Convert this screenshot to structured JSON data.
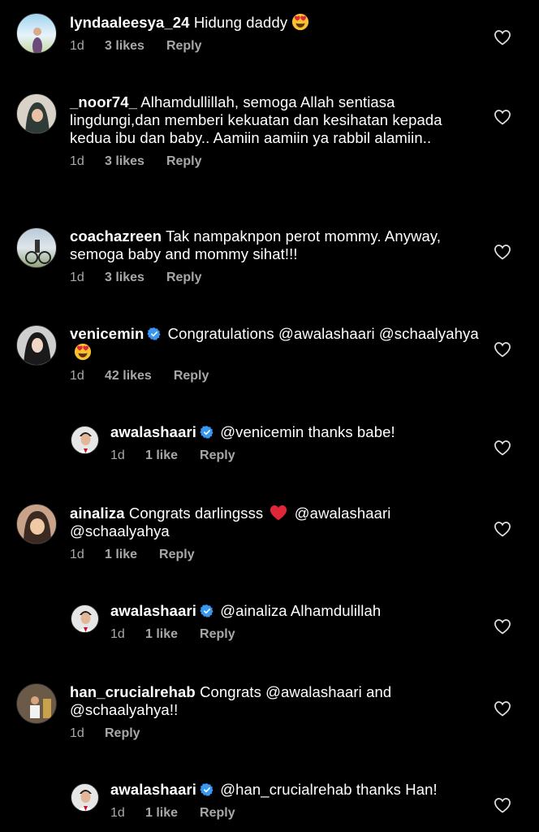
{
  "comments": [
    {
      "username": "lyndaaleesya_24",
      "verified": false,
      "text": "Hidung daddy",
      "emoji": "heart-eyes",
      "time": "1d",
      "likes": "3 likes",
      "reply": "Reply"
    },
    {
      "username": "_noor74_",
      "verified": false,
      "text": "Alhamdullillah, semoga Allah sentiasa lingdungi,dan memberi kekuatan dan kesihatan kepada kedua ibu dan baby.. Aamiin aamiin ya rabbil alamiin..",
      "time": "1d",
      "likes": "3 likes",
      "reply": "Reply"
    },
    {
      "username": "coachazreen",
      "verified": false,
      "text": "Tak nampaknpon perot mommy. Anyway, semoga baby and mommy sihat!!!",
      "time": "1d",
      "likes": "3 likes",
      "reply": "Reply"
    },
    {
      "username": "venicemin",
      "verified": true,
      "text": "Congratulations @awalashaari @schaalyahya",
      "emoji": "heart-eyes",
      "time": "1d",
      "likes": "42 likes",
      "reply": "Reply"
    },
    {
      "username": "awalashaari",
      "verified": true,
      "text": "@venicemin thanks babe!",
      "time": "1d",
      "likes": "1 like",
      "reply": "Reply"
    },
    {
      "username": "ainaliza",
      "verified": false,
      "text_before": "Congrats darlingsss",
      "text_after": "@awalashaari @schaalyahya",
      "emoji": "red-heart",
      "time": "1d",
      "likes": "1 like",
      "reply": "Reply"
    },
    {
      "username": "awalashaari",
      "verified": true,
      "text": "@ainaliza Alhamdulillah",
      "time": "1d",
      "likes": "1 like",
      "reply": "Reply"
    },
    {
      "username": "han_crucialrehab",
      "verified": false,
      "text": "Congrats @awalashaari and @schaalyahya!!",
      "time": "1d",
      "reply": "Reply"
    },
    {
      "username": "awalashaari",
      "verified": true,
      "text": "@han_crucialrehab thanks Han!",
      "time": "1d",
      "likes": "1 like",
      "reply": "Reply"
    }
  ],
  "colors": {
    "background": "#000000",
    "text": "#ffffff",
    "meta": "#a8a8a8",
    "verified": "#3897f0"
  }
}
